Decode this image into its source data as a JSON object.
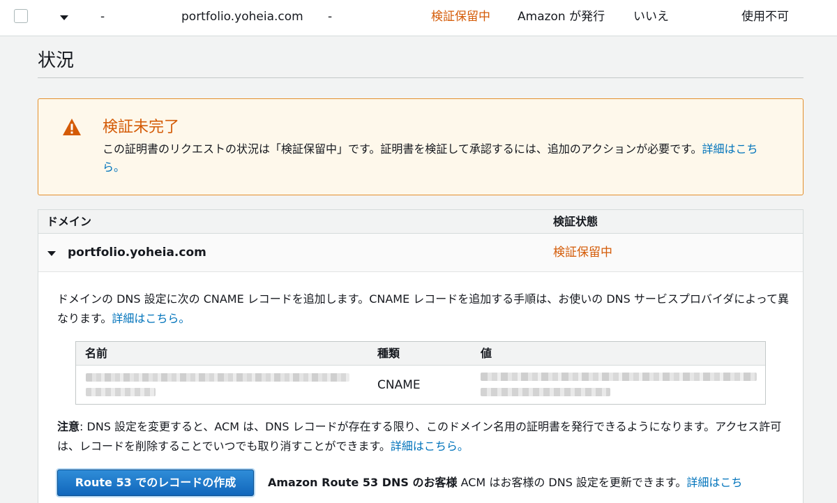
{
  "top_row": {
    "dash1": "-",
    "domain": "portfolio.yoheia.com",
    "dash2": "-",
    "status": "検証保留中",
    "issuer": "Amazon が発行",
    "in_use": "いいえ",
    "renewal": "使用不可"
  },
  "section": {
    "title": "状況"
  },
  "alert": {
    "title": "検証未完了",
    "body": "この証明書のリクエストの状況は「検証保留中」です。証明書を検証して承認するには、追加のアクションが必要です。",
    "link": "詳細はこちら。"
  },
  "domain_table": {
    "headers": {
      "domain": "ドメイン",
      "status": "検証状態"
    },
    "row": {
      "domain": "portfolio.yoheia.com",
      "status": "検証保留中"
    }
  },
  "detail": {
    "intro": "ドメインの DNS 設定に次の CNAME レコードを追加します。CNAME レコードを追加する手順は、お使いの DNS サービスプロバイダによって異なります。",
    "intro_link": "詳細はこちら。",
    "record_table": {
      "headers": {
        "name": "名前",
        "type": "種類",
        "value": "値"
      },
      "type": "CNAME"
    },
    "note_label": "注意",
    "note_colon": ":",
    "note_body": " DNS 設定を変更すると、ACM は、DNS レコードが存在する限り、このドメイン名用の証明書を発行できるようになります。アクセス許可は、レコードを削除することでいつでも取り消すことができます。",
    "note_link": "詳細はこちら。",
    "route53_button": "Route 53 でのレコードの作成",
    "route53_bold": "Amazon Route 53 DNS のお客様",
    "route53_text": " ACM はお客様の DNS 設定を更新できます。",
    "route53_link": "詳細はこち"
  },
  "colors": {
    "warning": "#d45b07",
    "link": "#0073bb",
    "alert_bg": "#fef8eb",
    "button": "#1166bb"
  }
}
